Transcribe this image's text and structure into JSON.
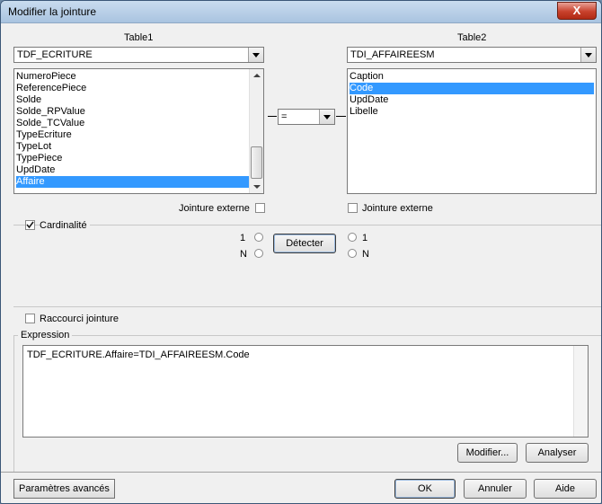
{
  "window": {
    "title": "Modifier la jointure",
    "close_glyph": "X"
  },
  "left": {
    "header": "Table1",
    "combo_value": "TDF_ECRITURE",
    "items": [
      "NumeroPiece",
      "ReferencePiece",
      "Solde",
      "Solde_RPValue",
      "Solde_TCValue",
      "TypeEcriture",
      "TypeLot",
      "TypePiece",
      "UpdDate",
      "Affaire"
    ],
    "selected_index": 9,
    "outer_join_label": "Jointure externe"
  },
  "right": {
    "header": "Table2",
    "combo_value": "TDI_AFFAIREESM",
    "items": [
      "Caption",
      "Code",
      "UpdDate",
      "Libelle"
    ],
    "selected_index": 1,
    "outer_join_label": "Jointure externe"
  },
  "operator": {
    "value": "="
  },
  "cardinality": {
    "label": "Cardinalité",
    "checked": true,
    "left_one": "1",
    "left_n": "N",
    "right_one": "1",
    "right_n": "N",
    "detect_label": "Détecter"
  },
  "shortcut": {
    "label": "Raccourci jointure"
  },
  "expression": {
    "label": "Expression",
    "value": "TDF_ECRITURE.Affaire=TDI_AFFAIREESM.Code",
    "modify_label": "Modifier...",
    "analyze_label": "Analyser"
  },
  "footer": {
    "advanced_label": "Paramètres avancés",
    "ok_label": "OK",
    "cancel_label": "Annuler",
    "help_label": "Aide"
  }
}
